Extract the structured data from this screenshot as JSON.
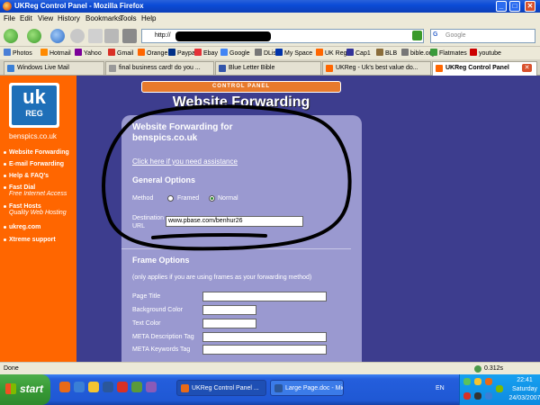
{
  "window": {
    "title": "UKReg Control Panel - Mozilla Firefox",
    "min": "_",
    "max": "□",
    "close": "✕"
  },
  "menu": [
    "File",
    "Edit",
    "View",
    "History",
    "Bookmarks",
    "Tools",
    "Help"
  ],
  "nav": {
    "url_prefix": "http://",
    "search_placeholder": "Google",
    "search_g": "G"
  },
  "bookmarks": [
    {
      "label": "Photos",
      "color": "#4a7fd6"
    },
    {
      "label": "Hotmail",
      "color": "#ff8a00"
    },
    {
      "label": "Yahoo",
      "color": "#7b0099"
    },
    {
      "label": "Gmail",
      "color": "#d93025"
    },
    {
      "label": "Orange",
      "color": "#ff6600"
    },
    {
      "label": "Paypal",
      "color": "#003087"
    },
    {
      "label": "Ebay",
      "color": "#e53238"
    },
    {
      "label": "Google",
      "color": "#4285f4"
    },
    {
      "label": "DList",
      "color": "#777777"
    },
    {
      "label": "My Space",
      "color": "#0033aa"
    },
    {
      "label": "UK Reg",
      "color": "#ff6600"
    },
    {
      "label": "Cap1",
      "color": "#333399"
    },
    {
      "label": "BLB",
      "color": "#8a6d3b"
    },
    {
      "label": "bible.org",
      "color": "#777777"
    },
    {
      "label": "Flatmates",
      "color": "#3a9a3a"
    },
    {
      "label": "youtube",
      "color": "#cc0000"
    }
  ],
  "tabs": [
    {
      "label": "Windows Live Mail",
      "color": "#3a7fd6"
    },
    {
      "label": "final business card! do you ...",
      "color": "#999999"
    },
    {
      "label": "Blue Letter Bible",
      "color": "#3355aa"
    },
    {
      "label": "UKReg - Uk's best value do...",
      "color": "#ff6600"
    },
    {
      "label": "UKReg Control Panel",
      "color": "#ff6600"
    }
  ],
  "tab_close": "✕",
  "sidebar": {
    "logo_uk": "uk",
    "logo_reg": "REG",
    "domain": "benspics.co.uk",
    "items": [
      {
        "label": "Website Forwarding",
        "sub": ""
      },
      {
        "label": "E-mail Forwarding",
        "sub": ""
      },
      {
        "label": "Help & FAQ's",
        "sub": ""
      },
      {
        "label": "Fast Dial",
        "sub": "Free Internet Access"
      },
      {
        "label": "Fast Hosts",
        "sub": "Quality Web Hosting"
      },
      {
        "label": "ukreg.com",
        "sub": ""
      },
      {
        "label": "Xtreme support",
        "sub": ""
      }
    ]
  },
  "main": {
    "control_panel": "CONTROL PANEL",
    "heading": "Website Forwarding",
    "panel_title_1": "Website Forwarding for",
    "panel_title_2": "benspics.co.uk",
    "assist_link": "Click here if you need assistance",
    "general_options": "General Options",
    "method_label": "Method",
    "method_framed": "Framed",
    "method_normal": "Normal",
    "method_selected": "Normal",
    "dest_label_1": "Destination",
    "dest_label_2": "URL",
    "dest_value": "www.pbase.com/benhur26",
    "frame_options": "Frame Options",
    "frame_note": "(only applies if you are using frames as your forwarding method)",
    "page_title": "Page Title",
    "bg_color": "Background Color",
    "text_color": "Text Color",
    "meta_desc": "META Description Tag",
    "meta_keywords": "META Keywords Tag"
  },
  "status": {
    "text": "Done",
    "time": "0.312s"
  },
  "taskbar": {
    "start": "start",
    "tasks": [
      {
        "label": "UKReg Control Panel ...",
        "color": "#e86a17"
      },
      {
        "label": "Large Page.doc - Micr...",
        "color": "#2b579a"
      }
    ],
    "lang": "EN",
    "clock_time": "22:41",
    "clock_day": "Saturday",
    "clock_date": "24/03/2007"
  }
}
